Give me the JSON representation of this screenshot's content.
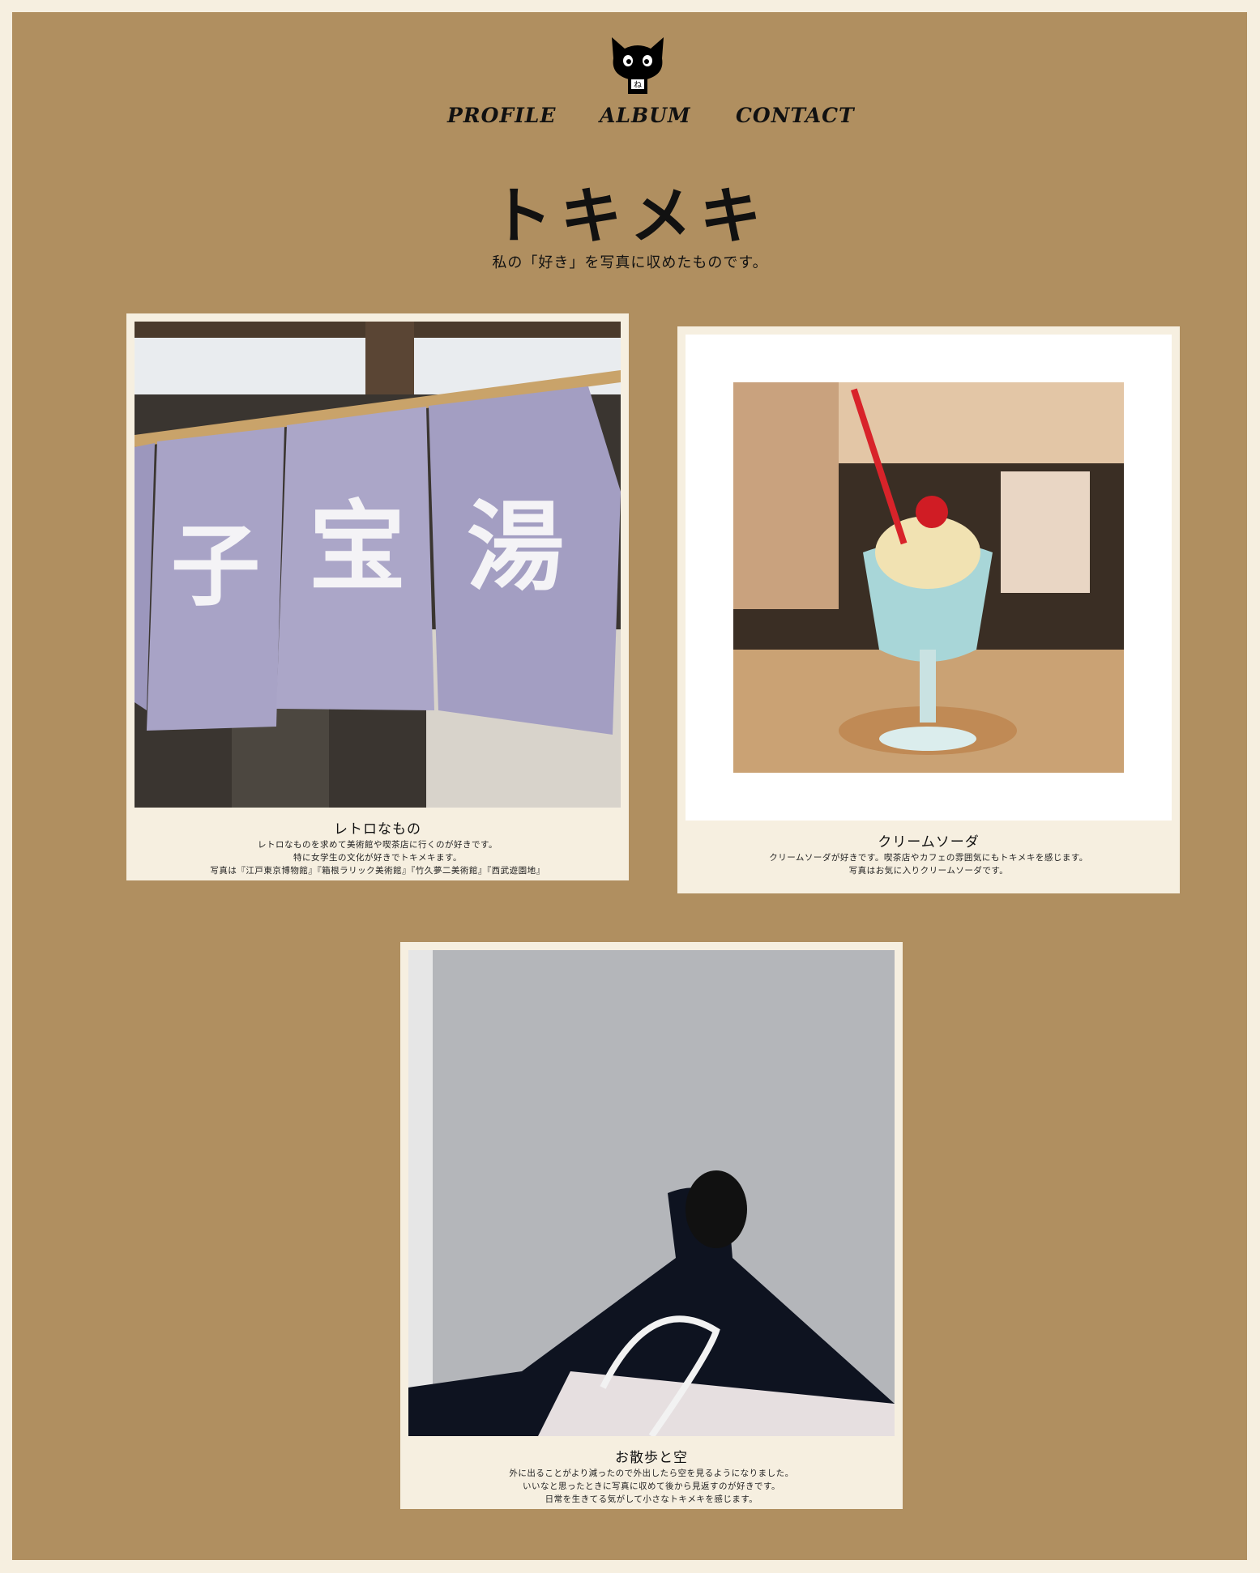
{
  "nav": {
    "items": [
      {
        "label": "PROFILE"
      },
      {
        "label": "ALBUM"
      },
      {
        "label": "CONTACT"
      }
    ]
  },
  "logo": {
    "icon": "black-cat-logo-icon"
  },
  "hero": {
    "title": "トキメキ",
    "subtitle": "私の「好き」を写真に収めたものです。"
  },
  "cards": [
    {
      "title": "レトロなもの",
      "lines": [
        "レトロなものを求めて美術館や喫茶店に行くのが好きです。",
        "特に女学生の文化が好きでトキメキます。",
        "写真は『江戸東京博物館』『箱根ラリック美術館』『竹久夢二美術館』『西武遊園地』"
      ],
      "photo": "noren-curtain-photo",
      "photo_text": [
        "子",
        "宝",
        "湯"
      ]
    },
    {
      "title": "クリームソーダ",
      "lines": [
        "クリームソーダが好きです。喫茶店やカフェの雰囲気にもトキメキを感じます。",
        "写真はお気に入りクリームソーダです。"
      ],
      "photo": "cream-soda-photo"
    },
    {
      "title": "お散歩と空",
      "lines": [
        "外に出ることがより減ったので外出したら空を見るようになりました。",
        "いいなと思ったときに写真に収めて後から見返すのが好きです。",
        "日常を生きてる気がして小さなトキメキを感じます。"
      ],
      "photo": "walking-pavement-photo"
    }
  ],
  "colors": {
    "page_background": "#f6efe0",
    "frame_background": "#b08f60",
    "card_background": "#f6efe0"
  }
}
